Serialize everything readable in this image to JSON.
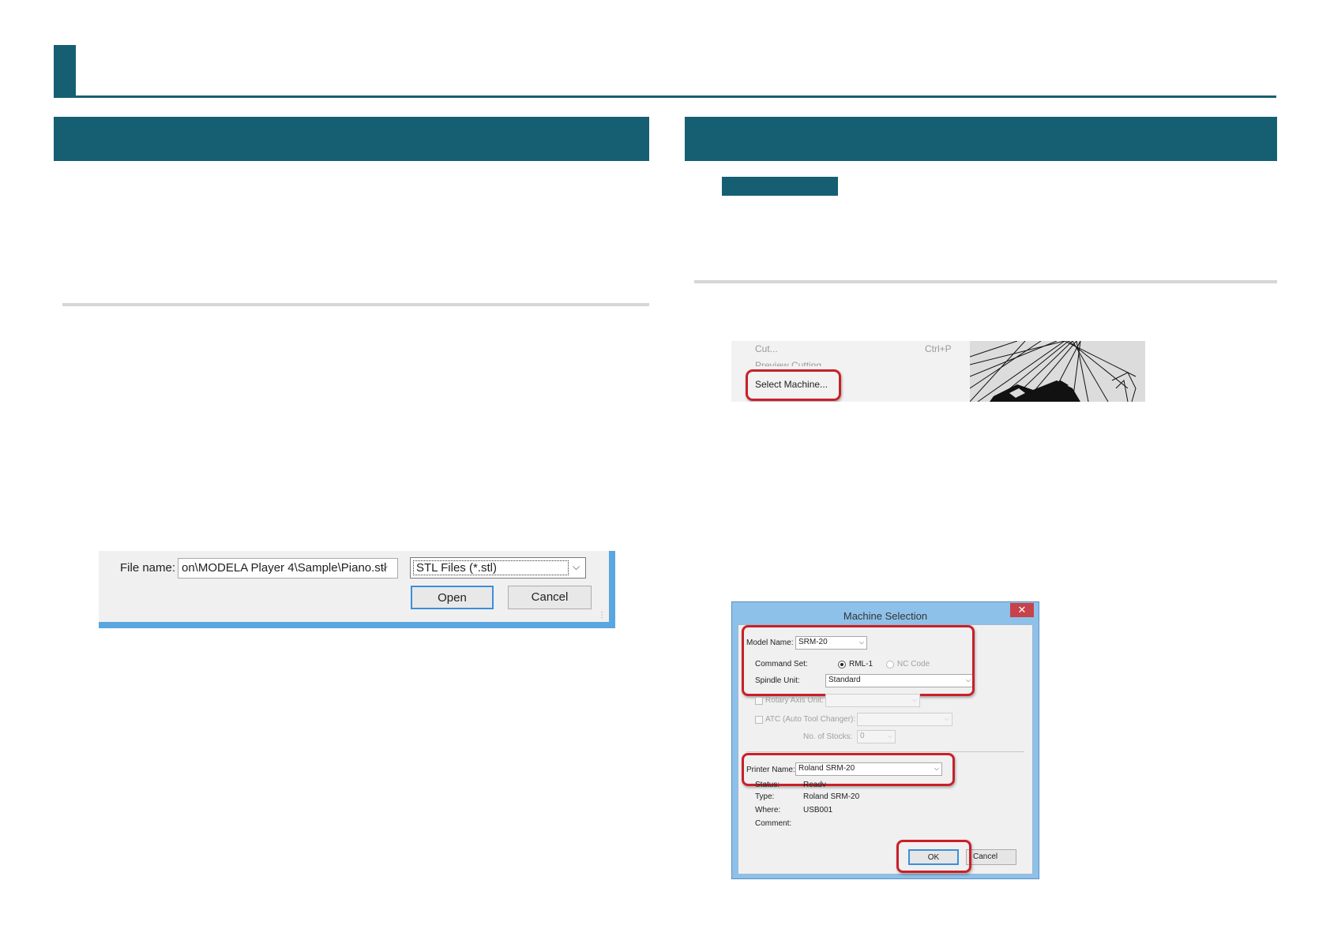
{
  "file_dialog": {
    "file_name_label": "File name:",
    "file_name_value": "on\\MODELA Player 4\\Sample\\Piano.stl",
    "file_type_value": "STL Files (*.stl)",
    "open_label": "Open",
    "cancel_label": "Cancel"
  },
  "menu": {
    "cut_label": "Cut...",
    "cut_shortcut": "Ctrl+P",
    "preview_label": "Preview Cutting...",
    "select_machine_label": "Select Machine..."
  },
  "machine_selection": {
    "title": "Machine Selection",
    "close_glyph": "✕",
    "model_name_label": "Model Name:",
    "model_name_value": "SRM-20",
    "command_set_label": "Command Set:",
    "command_options": [
      "RML-1",
      "NC Code"
    ],
    "spindle_unit_label": "Spindle Unit:",
    "spindle_unit_value": "Standard",
    "rotary_axis_label": "Rotary Axis Unit:",
    "atc_label": "ATC (Auto Tool Changer):",
    "stocks_label": "No. of Stocks:",
    "stocks_value": "0",
    "printer_name_label": "Printer Name:",
    "printer_name_value": "Roland SRM-20",
    "status_label": "Status:",
    "status_value": "Ready",
    "type_label": "Type:",
    "type_value": "Roland SRM-20",
    "where_label": "Where:",
    "where_value": "USB001",
    "comment_label": "Comment:",
    "ok_label": "OK",
    "cancel_label": "Cancel"
  },
  "colors": {
    "accent": "#165f73",
    "callout": "#c8202a",
    "dialog_frame": "#8ec1ea"
  }
}
